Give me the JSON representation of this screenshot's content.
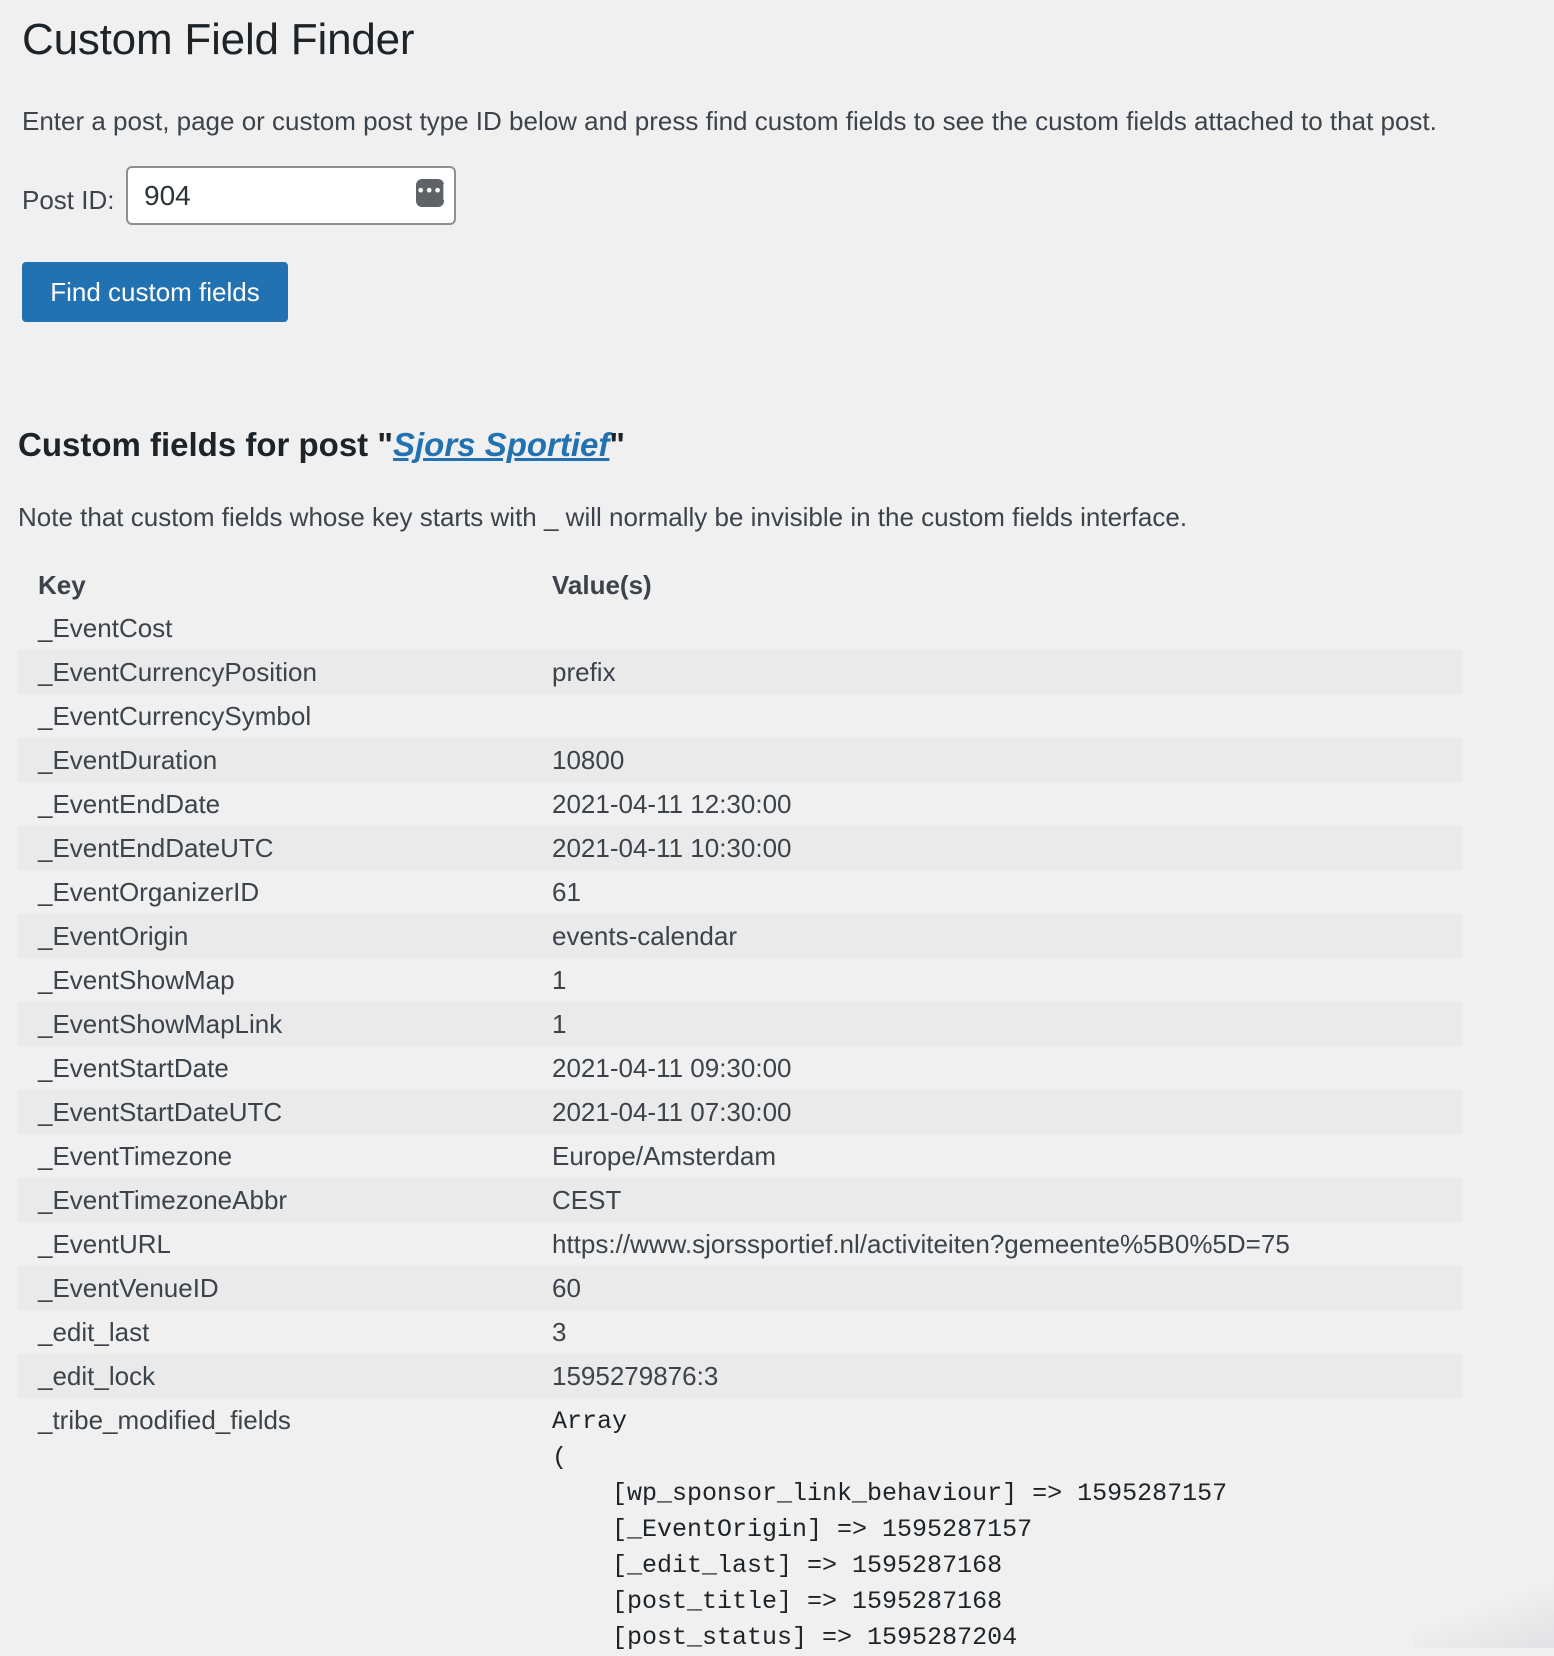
{
  "page": {
    "title": "Custom Field Finder",
    "intro": "Enter a post, page or custom post type ID below and press find custom fields to see the custom fields attached to that post."
  },
  "form": {
    "post_id_label": "Post ID:",
    "post_id_value": "904",
    "password_manager_icon": "password-dots-icon",
    "submit_label": "Find custom fields"
  },
  "results": {
    "heading_prefix": "Custom fields for post \"",
    "post_title": "Sjors Sportief",
    "heading_suffix": "\"",
    "note": "Note that custom fields whose key starts with _ will normally be invisible in the custom fields interface.",
    "columns": {
      "key": "Key",
      "values": "Value(s)"
    },
    "rows": [
      {
        "key": "_EventCost",
        "value": ""
      },
      {
        "key": "_EventCurrencyPosition",
        "value": "prefix"
      },
      {
        "key": "_EventCurrencySymbol",
        "value": ""
      },
      {
        "key": "_EventDuration",
        "value": "10800"
      },
      {
        "key": "_EventEndDate",
        "value": "2021-04-11 12:30:00"
      },
      {
        "key": "_EventEndDateUTC",
        "value": "2021-04-11 10:30:00"
      },
      {
        "key": "_EventOrganizerID",
        "value": "61"
      },
      {
        "key": "_EventOrigin",
        "value": "events-calendar"
      },
      {
        "key": "_EventShowMap",
        "value": "1"
      },
      {
        "key": "_EventShowMapLink",
        "value": "1"
      },
      {
        "key": "_EventStartDate",
        "value": "2021-04-11 09:30:00"
      },
      {
        "key": "_EventStartDateUTC",
        "value": "2021-04-11 07:30:00"
      },
      {
        "key": "_EventTimezone",
        "value": "Europe/Amsterdam"
      },
      {
        "key": "_EventTimezoneAbbr",
        "value": "CEST"
      },
      {
        "key": "_EventURL",
        "value": "https://www.sjorssportief.nl/activiteiten?gemeente%5B0%5D=75"
      },
      {
        "key": "_EventVenueID",
        "value": "60"
      },
      {
        "key": "_edit_last",
        "value": "3"
      },
      {
        "key": "_edit_lock",
        "value": "1595279876:3"
      }
    ],
    "array_row": {
      "key": "_tribe_modified_fields",
      "value": "Array\n(\n    [wp_sponsor_link_behaviour] => 1595287157\n    [_EventOrigin] => 1595287157\n    [_edit_last] => 1595287168\n    [post_title] => 1595287168\n    [post_status] => 1595287204"
    }
  }
}
